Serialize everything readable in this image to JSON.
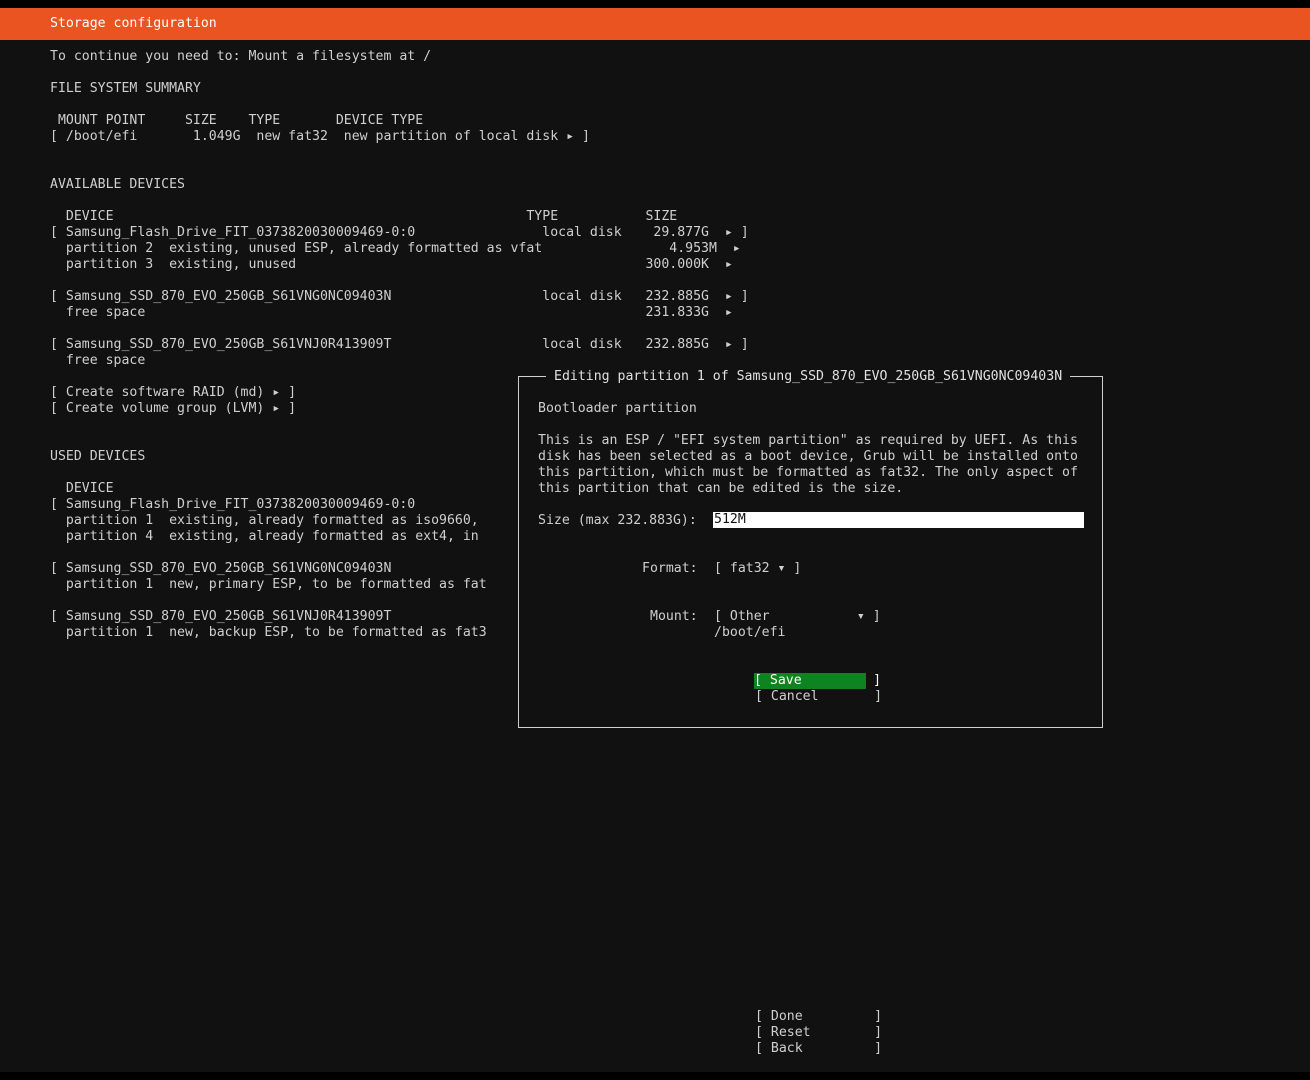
{
  "header": {
    "title": "Storage configuration",
    "accent_color": "#e95420"
  },
  "status": "To continue you need to: Mount a filesystem at /",
  "fs_summary": {
    "heading": "FILE SYSTEM SUMMARY",
    "columns": " MOUNT POINT     SIZE    TYPE       DEVICE TYPE",
    "rows": [
      "[ /boot/efi       1.049G  new fat32  new partition of local disk ▸ ]"
    ]
  },
  "available": {
    "heading": "AVAILABLE DEVICES",
    "columns": "  DEVICE                                                    TYPE           SIZE",
    "lines": [
      "[ Samsung_Flash_Drive_FIT_0373820030009469-0:0                local disk    29.877G  ▸ ]",
      "  partition 2  existing, unused ESP, already formatted as vfat                4.953M  ▸",
      "  partition 3  existing, unused                                            300.000K  ▸",
      "",
      "[ Samsung_SSD_870_EVO_250GB_S61VNG0NC09403N                   local disk   232.885G  ▸ ]",
      "  free space                                                               231.833G  ▸",
      "",
      "[ Samsung_SSD_870_EVO_250GB_S61VNJ0R413909T                   local disk   232.885G  ▸ ]",
      "  free space",
      "",
      "[ Create software RAID (md) ▸ ]",
      "[ Create volume group (LVM) ▸ ]"
    ]
  },
  "used": {
    "heading": "USED DEVICES",
    "columns": "  DEVICE",
    "lines": [
      "[ Samsung_Flash_Drive_FIT_0373820030009469-0:0",
      "  partition 1  existing, already formatted as iso9660,",
      "  partition 4  existing, already formatted as ext4, in",
      "",
      "[ Samsung_SSD_870_EVO_250GB_S61VNG0NC09403N",
      "  partition 1  new, primary ESP, to be formatted as fat",
      "",
      "[ Samsung_SSD_870_EVO_250GB_S61VNJ0R413909T",
      "  partition 1  new, backup ESP, to be formatted as fat3"
    ]
  },
  "dialog": {
    "title": "Editing partition 1 of Samsung_SSD_870_EVO_250GB_S61VNG0NC09403N",
    "subtitle": "Bootloader partition",
    "description": [
      "This is an ESP / \"EFI system partition\" as required by UEFI. As this",
      "disk has been selected as a boot device, Grub will be installed onto",
      "this partition, which must be formatted as fat32. The only aspect of",
      "this partition that can be edited is the size."
    ],
    "size_label": "Size (max 232.883G):",
    "size_value": "512M",
    "format_label": "Format:",
    "format_value": "[ fat32 ▾ ]",
    "mount_label": "Mount:",
    "mount_value": "[ Other           ▾ ]",
    "mount_path": "/boot/efi",
    "save_label": "[ Save         ]",
    "cancel_label": "[ Cancel       ]",
    "save_color": "#0e8420"
  },
  "actions": {
    "done": "[ Done         ]",
    "reset": "[ Reset        ]",
    "back": "[ Back         ]"
  }
}
